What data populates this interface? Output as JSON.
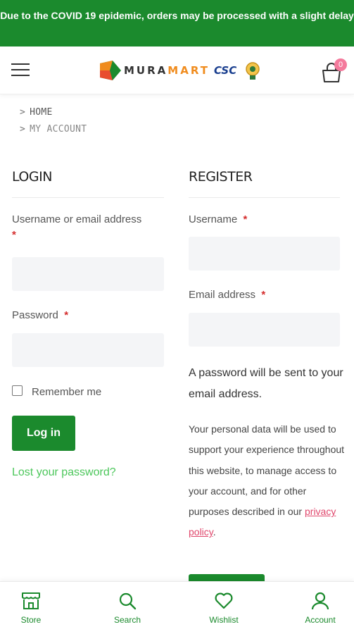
{
  "banner": {
    "prefix": "Due to the ",
    "bold": "COVID 19",
    "suffix": " epidemic, orders may be processed with a slight delay"
  },
  "header": {
    "logo_text_mura": "MURA",
    "logo_text_mart": "MART",
    "csc_text": "CSC",
    "cart_count": "0"
  },
  "breadcrumb": {
    "items": [
      "HOME",
      "MY ACCOUNT"
    ]
  },
  "login": {
    "title": "LOGIN",
    "username_label": "Username or email address",
    "password_label": "Password",
    "remember_label": "Remember me",
    "button_label": "Log in",
    "lost_password": "Lost your password?"
  },
  "register": {
    "title": "REGISTER",
    "username_label": "Username",
    "email_label": "Email address",
    "note": "A password will be sent to your email address.",
    "privacy_prefix": "Your personal data will be used to support your experience throughout this website, to manage access to your account, and for other purposes described in our ",
    "privacy_link": "privacy policy",
    "privacy_suffix": "."
  },
  "required_marker": "*",
  "bottom_nav": {
    "store": "Store",
    "search": "Search",
    "wishlist": "Wishlist",
    "account": "Account"
  },
  "colors": {
    "primary_green": "#1b8a2d",
    "link_green": "#4cc75b",
    "required_red": "#d42c2c",
    "privacy_pink": "#e0476c"
  }
}
